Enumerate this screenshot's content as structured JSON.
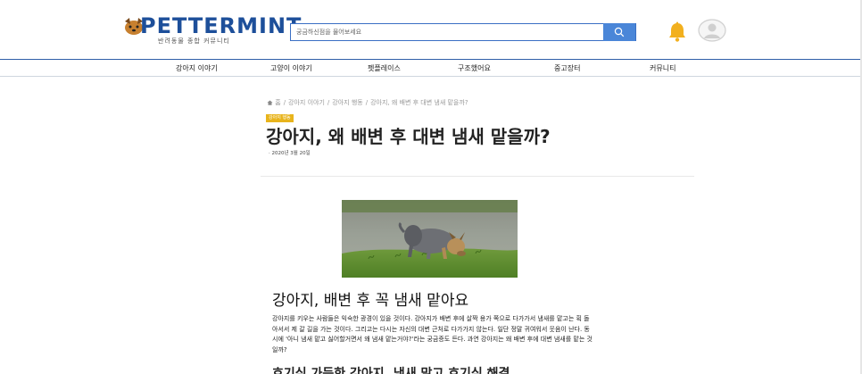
{
  "header": {
    "logo_text": "PETTERMINT",
    "logo_sub": "반려동물 종합 커뮤니티",
    "search_placeholder": "궁금하신점을 물어보세요",
    "search_icon": "search-icon",
    "bell_icon": "bell-icon",
    "avatar_icon": "user-avatar-icon"
  },
  "nav": {
    "items": [
      {
        "label": "강아지 이야기"
      },
      {
        "label": "고양이 이야기"
      },
      {
        "label": "펫플레이스"
      },
      {
        "label": "구조했어요"
      },
      {
        "label": "중고장터"
      },
      {
        "label": "커뮤니티"
      }
    ]
  },
  "article": {
    "breadcrumb": {
      "home": "홈",
      "level1": "강아지 이야기",
      "level2": "강아지 행동",
      "current": "강아지, 왜 배변 후 대변 냄새 맡을까?"
    },
    "category_badge": "강아지 행동",
    "title": "강아지, 왜 배변 후 대변 냄새 맡을까?",
    "date": "2020년 3월 20일",
    "heading": "강아지, 배변 후 꼭 냄새 맡아요",
    "body": "강아지를 키우는 사람들은 익숙한 광경이 있을 것이다. 강아지가 배변 후에 살짝 용가 쪽으로 다가가서 냄새를 맡고는 획 돌아서서 제 갈 길을 가는 것이다. 그리고는 다시는 자신의 대변 근처로 다가가지 않는다. 일단 정말 귀여워서 웃음이 난다. 동시에 '아니 냄새 맡고 싫어할거면서 왜 냄새 맡는거야?'라는 궁금증도 든다. 과연 강아지는 왜 배변 후에 대변 냄새를 맡는 것일까?",
    "subheading": "호기심 가득한 강아지, 냄새 맡고 호기심 해결"
  },
  "colors": {
    "brand_blue": "#1d4f9a",
    "search_button": "#4a86d8",
    "badge": "#e8b41c",
    "bell": "#f2b01e"
  }
}
